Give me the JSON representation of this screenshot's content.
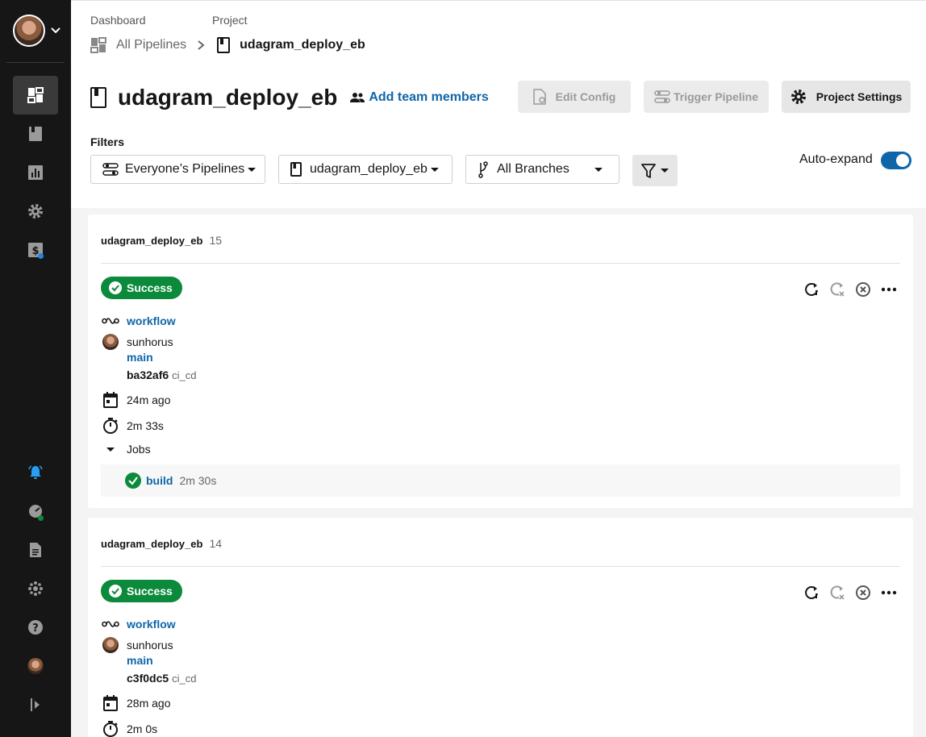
{
  "sidebar": {
    "items": [
      {
        "icon": "dashboard-icon",
        "active": true
      },
      {
        "icon": "projects-icon",
        "active": false
      },
      {
        "icon": "insights-icon",
        "active": false
      },
      {
        "icon": "settings-icon",
        "active": false
      },
      {
        "icon": "plan-icon",
        "active": false
      },
      {
        "icon": "notifications-icon",
        "active": false
      },
      {
        "icon": "status-icon",
        "active": false
      },
      {
        "icon": "docs-icon",
        "active": false
      },
      {
        "icon": "community-icon",
        "active": false
      },
      {
        "icon": "help-icon",
        "active": false
      },
      {
        "icon": "user-icon",
        "active": false
      },
      {
        "icon": "collapse-icon",
        "active": false
      }
    ]
  },
  "breadcrumb": {
    "dashboard_label": "Dashboard",
    "project_label": "Project",
    "dashboard_value": "All Pipelines",
    "project_value": "udagram_deploy_eb"
  },
  "header": {
    "title": "udagram_deploy_eb",
    "add_team": "Add team members",
    "edit_config": "Edit Config",
    "trigger_pipeline": "Trigger Pipeline",
    "project_settings": "Project Settings"
  },
  "filters": {
    "label": "Filters",
    "pipelines": "Everyone’s Pipelines",
    "project": "udagram_deploy_eb",
    "branches": "All Branches",
    "auto_expand": "Auto-expand",
    "auto_expand_on": true
  },
  "pipelines": [
    {
      "project": "udagram_deploy_eb",
      "number": "15",
      "status": "Success",
      "workflow": "workflow",
      "user": "sunhorus",
      "branch": "main",
      "commit": "ba32af6",
      "commit_msg": "ci_cd",
      "time_ago": "24m ago",
      "duration": "2m 33s",
      "jobs_label": "Jobs",
      "job": {
        "name": "build",
        "duration": "2m 30s"
      }
    },
    {
      "project": "udagram_deploy_eb",
      "number": "14",
      "status": "Success",
      "workflow": "workflow",
      "user": "sunhorus",
      "branch": "main",
      "commit": "c3f0dc5",
      "commit_msg": "ci_cd",
      "time_ago": "28m ago",
      "duration": "2m 0s"
    }
  ],
  "colors": {
    "accent": "#0e66a9",
    "success": "#0b8a3b",
    "sidebar": "#161616"
  }
}
